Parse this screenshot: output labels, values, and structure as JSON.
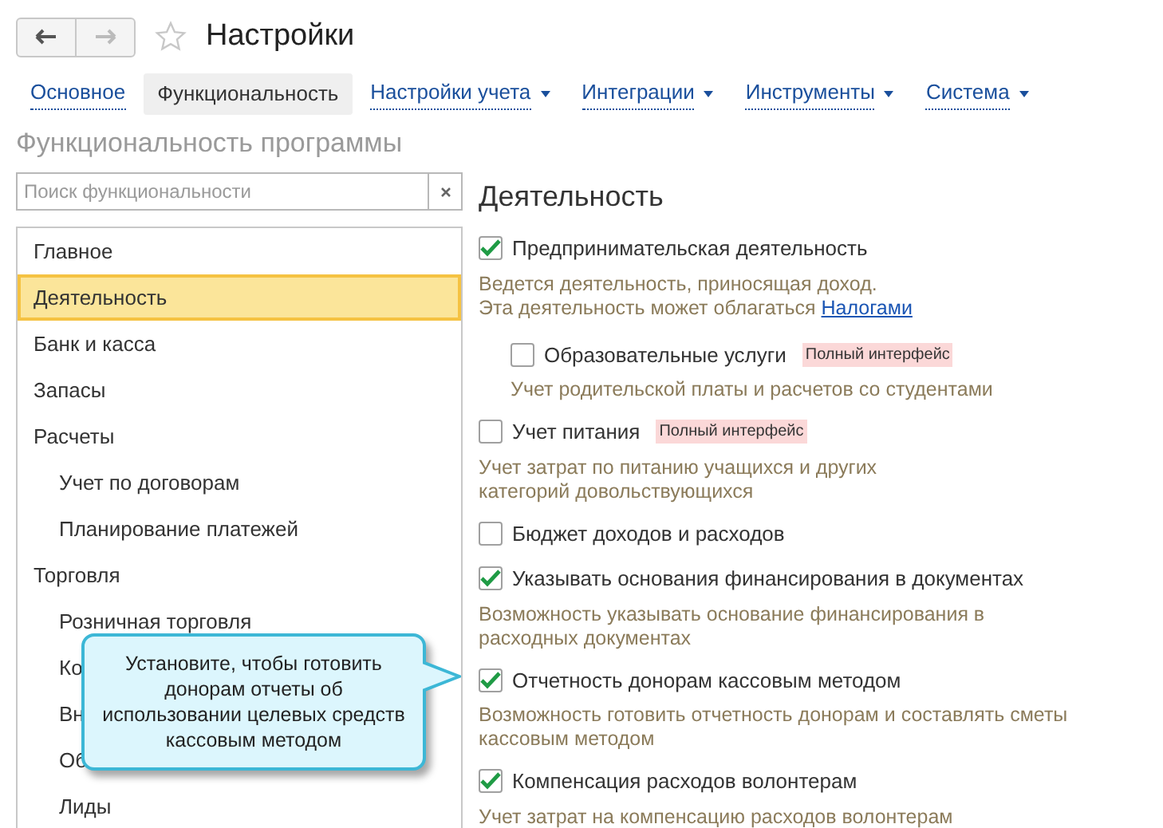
{
  "window": {
    "title": "Настройки",
    "favorite": false
  },
  "tabs": [
    {
      "label": "Основное",
      "selected": false,
      "dropdown": false
    },
    {
      "label": "Функциональность",
      "selected": true,
      "dropdown": false
    },
    {
      "label": "Настройки учета",
      "selected": false,
      "dropdown": true
    },
    {
      "label": "Интеграции",
      "selected": false,
      "dropdown": true
    },
    {
      "label": "Инструменты",
      "selected": false,
      "dropdown": true
    },
    {
      "label": "Система",
      "selected": false,
      "dropdown": true
    }
  ],
  "heading": "Функциональность программы",
  "search": {
    "placeholder": "Поиск функциональности"
  },
  "sections": [
    {
      "label": "Главное",
      "selected": false
    },
    {
      "label": "Деятельность",
      "selected": true
    },
    {
      "label": "Банк и касса",
      "selected": false
    },
    {
      "label": "Запасы",
      "selected": false
    },
    {
      "label": "Расчеты",
      "selected": false,
      "children": [
        {
          "label": "Учет по договорам",
          "selected": false
        },
        {
          "label": "Планирование платежей",
          "selected": false
        }
      ]
    },
    {
      "label": "Торговля",
      "selected": false,
      "children": [
        {
          "label": "Розничная торговля",
          "selected": false
        },
        {
          "label": "Ко",
          "selected": false
        },
        {
          "label": "Вн",
          "selected": false
        },
        {
          "label": "Об",
          "selected": false
        },
        {
          "label": "Лиды",
          "selected": false
        }
      ]
    }
  ],
  "panel_title": "Деятельность",
  "options": [
    {
      "label": "Предпринимательская деятельность",
      "checked": true,
      "description": [
        "Ведется деятельность, приносящая доход.",
        "Эта деятельность может облагаться"
      ],
      "link": "Налогами",
      "children": [
        {
          "label": "Образовательные услуги",
          "checked": false,
          "badge": "Полный интерфейс",
          "description": [
            "Учет родительской платы и расчетов со студентами"
          ]
        }
      ]
    },
    {
      "label": "Учет питания",
      "checked": false,
      "badge": "Полный интерфейс",
      "description": [
        "Учет затрат по питанию учащихся и других",
        "категорий довольствующихся"
      ]
    },
    {
      "label": "Бюджет доходов и расходов",
      "checked": false
    },
    {
      "label": "Указывать основания финансирования в документах",
      "checked": true,
      "description": [
        "Возможность указывать основание финансирования в",
        "расходных документах"
      ]
    },
    {
      "label": "Отчетность донорам кассовым методом",
      "checked": true,
      "description": [
        "Возможность готовить отчетность донорам и составлять сметы",
        "кассовым методом"
      ]
    },
    {
      "label": "Компенсация расходов волонтерам",
      "checked": true,
      "description": [
        "Учет затрат на компенсацию расходов волонтерам"
      ]
    }
  ],
  "callout": [
    "Установите, чтобы готовить",
    "донорам отчеты об",
    "использовании целевых средств",
    "кассовым методом"
  ]
}
